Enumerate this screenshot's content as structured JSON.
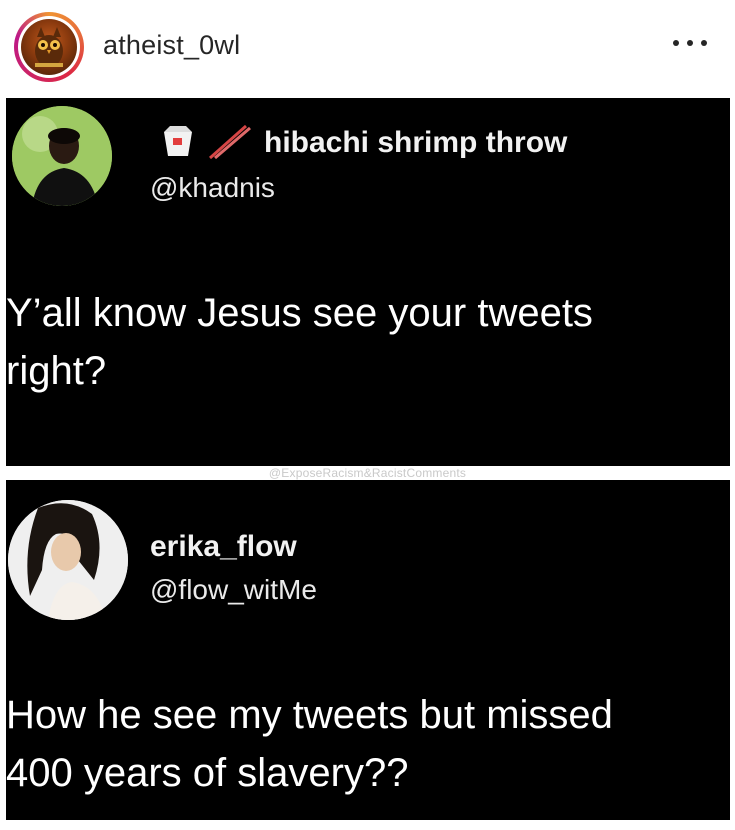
{
  "post": {
    "username": "atheist_0wl",
    "more_icon": "more-horizontal-icon"
  },
  "tweet1": {
    "display_name": "hibachi shrimp throw",
    "handle": "@khadnis",
    "name_emojis": [
      "takeout-box-emoji",
      "chopsticks-emoji"
    ],
    "text": "Y’all know Jesus see your tweets\nright?"
  },
  "watermark": "@ExposeRacism&RacistComments",
  "tweet2": {
    "display_name": "erika_flow",
    "handle": "@flow_witMe",
    "text": "How he see my tweets but missed\n400 years of slavery??"
  }
}
